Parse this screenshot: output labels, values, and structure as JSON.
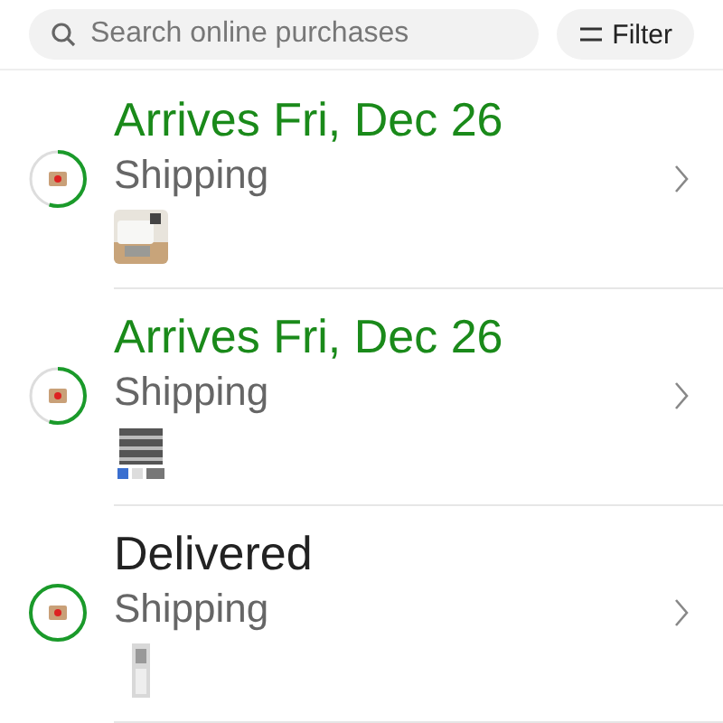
{
  "search": {
    "placeholder": "Search online purchases"
  },
  "filter_button": {
    "label": "Filter"
  },
  "orders": [
    {
      "kind": "arriving",
      "status": "Arrives Fri, Dec 26",
      "subtitle": "Shipping"
    },
    {
      "kind": "arriving",
      "status": "Arrives Fri, Dec 26",
      "subtitle": "Shipping"
    },
    {
      "kind": "delivered",
      "status": "Delivered",
      "subtitle": "Shipping"
    }
  ]
}
